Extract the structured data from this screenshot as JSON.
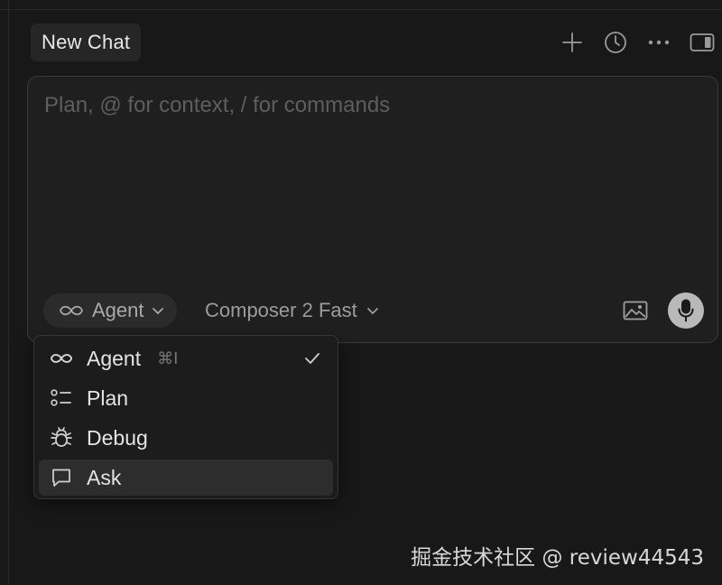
{
  "header": {
    "tab_title": "New Chat",
    "icons": [
      "plus-icon",
      "history-icon",
      "more-icon",
      "panel-icon"
    ]
  },
  "composer": {
    "placeholder": "Plan, @ for context, / for commands",
    "value": "",
    "mode_label": "Agent",
    "model_label": "Composer 2 Fast"
  },
  "mode_menu": {
    "items": [
      {
        "label": "Agent",
        "icon": "infinity-icon",
        "shortcut": "⌘I",
        "checked": true
      },
      {
        "label": "Plan",
        "icon": "plan-list-icon",
        "shortcut": "",
        "checked": false
      },
      {
        "label": "Debug",
        "icon": "bug-icon",
        "shortcut": "",
        "checked": false
      },
      {
        "label": "Ask",
        "icon": "chat-bubble-icon",
        "shortcut": "",
        "checked": false
      }
    ],
    "hovered_index": 3
  },
  "watermark": "掘金技术社区 @ review44543",
  "colors": {
    "background": "#181818",
    "composer_bg": "#1f1f1f",
    "menu_bg": "#1c1c1c",
    "hover_bg": "#2d2d2d",
    "mic_bg": "#b9b9b9"
  }
}
